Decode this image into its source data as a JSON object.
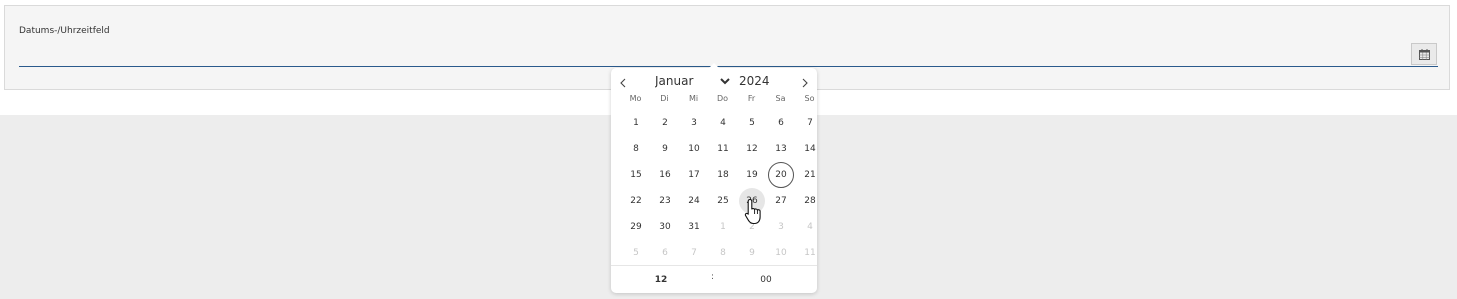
{
  "field": {
    "label": "Datums-/Uhrzeitfeld",
    "value": "",
    "calendar_button_icon": "calendar-icon",
    "accent_color": "#2a5a8c"
  },
  "calendar": {
    "prev_icon": "chevron-left-icon",
    "next_icon": "chevron-right-icon",
    "month": "Januar",
    "year": "2024",
    "weekdays": [
      "Mo",
      "Di",
      "Mi",
      "Do",
      "Fr",
      "Sa",
      "So"
    ],
    "weeks": [
      [
        {
          "d": "1"
        },
        {
          "d": "2"
        },
        {
          "d": "3"
        },
        {
          "d": "4"
        },
        {
          "d": "5"
        },
        {
          "d": "6"
        },
        {
          "d": "7"
        }
      ],
      [
        {
          "d": "8"
        },
        {
          "d": "9"
        },
        {
          "d": "10"
        },
        {
          "d": "11"
        },
        {
          "d": "12"
        },
        {
          "d": "13"
        },
        {
          "d": "14"
        }
      ],
      [
        {
          "d": "15"
        },
        {
          "d": "16"
        },
        {
          "d": "17"
        },
        {
          "d": "18"
        },
        {
          "d": "19"
        },
        {
          "d": "20",
          "state": "today"
        },
        {
          "d": "21"
        }
      ],
      [
        {
          "d": "22"
        },
        {
          "d": "23"
        },
        {
          "d": "24"
        },
        {
          "d": "25"
        },
        {
          "d": "26",
          "state": "hover"
        },
        {
          "d": "27"
        },
        {
          "d": "28"
        }
      ],
      [
        {
          "d": "29"
        },
        {
          "d": "30"
        },
        {
          "d": "31"
        },
        {
          "d": "1",
          "state": "other"
        },
        {
          "d": "2",
          "state": "other"
        },
        {
          "d": "3",
          "state": "other"
        },
        {
          "d": "4",
          "state": "other"
        }
      ],
      [
        {
          "d": "5",
          "state": "other"
        },
        {
          "d": "6",
          "state": "other"
        },
        {
          "d": "7",
          "state": "other"
        },
        {
          "d": "8",
          "state": "other"
        },
        {
          "d": "9",
          "state": "other"
        },
        {
          "d": "10",
          "state": "other"
        },
        {
          "d": "11",
          "state": "other"
        }
      ]
    ],
    "time": {
      "hour": "12",
      "separator": ":",
      "minute": "00"
    }
  },
  "cursor_icon": "hand-pointer-icon"
}
